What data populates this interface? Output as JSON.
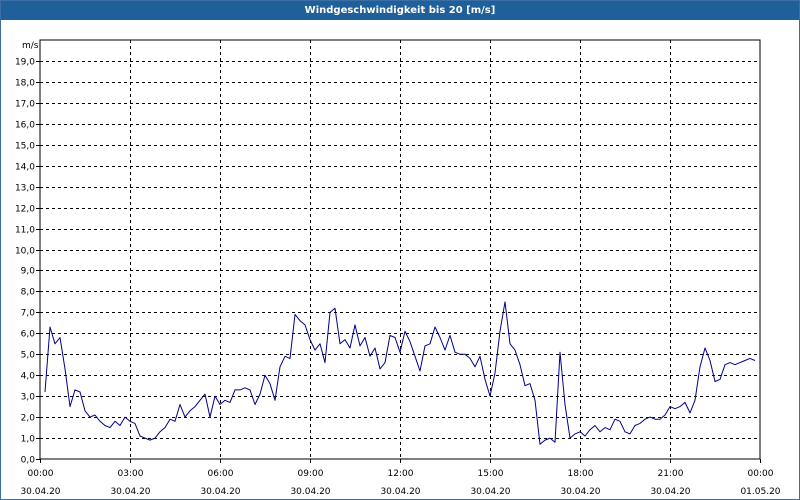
{
  "window": {
    "title": "Windgeschwindigkeit bis 20 [m/s]"
  },
  "chart_data": {
    "type": "line",
    "title": "Windgeschwindigkeit bis 20 [m/s]",
    "ylabel": "m/s",
    "ylim": [
      0,
      20
    ],
    "y_ticks": [
      "0,0",
      "1,0",
      "2,0",
      "3,0",
      "4,0",
      "5,0",
      "6,0",
      "7,0",
      "8,0",
      "9,0",
      "10,0",
      "11,0",
      "12,0",
      "13,0",
      "14,0",
      "15,0",
      "16,0",
      "17,0",
      "18,0",
      "19,0"
    ],
    "x_ticks": [
      {
        "time": "00:00",
        "date": "30.04.20"
      },
      {
        "time": "03:00",
        "date": "30.04.20"
      },
      {
        "time": "06:00",
        "date": "30.04.20"
      },
      {
        "time": "09:00",
        "date": "30.04.20"
      },
      {
        "time": "12:00",
        "date": "30.04.20"
      },
      {
        "time": "15:00",
        "date": "30.04.20"
      },
      {
        "time": "18:00",
        "date": "30.04.20"
      },
      {
        "time": "21:00",
        "date": "30.04.20"
      },
      {
        "time": "00:00",
        "date": "01.05.20"
      }
    ],
    "grid": true,
    "line_color": "#00008b",
    "series": [
      {
        "x": [
          "00:10",
          "00:20",
          "00:30",
          "00:40",
          "00:50",
          "01:00",
          "01:10",
          "01:20",
          "01:30",
          "01:40",
          "01:50",
          "02:00",
          "02:10",
          "02:20",
          "02:30",
          "02:40",
          "02:50",
          "03:00",
          "03:10",
          "03:20",
          "03:30",
          "03:40",
          "03:50",
          "04:00",
          "04:10",
          "04:20",
          "04:30",
          "04:40",
          "04:50",
          "05:00",
          "05:10",
          "05:20",
          "05:30",
          "05:40",
          "05:50",
          "06:00",
          "06:10",
          "06:20",
          "06:30",
          "06:40",
          "06:50",
          "07:00",
          "07:10",
          "07:20",
          "07:30",
          "07:40",
          "07:50",
          "08:00",
          "08:10",
          "08:20",
          "08:30",
          "08:40",
          "08:50",
          "09:00",
          "09:10",
          "09:20",
          "09:30",
          "09:40",
          "09:50",
          "10:00",
          "10:10",
          "10:20",
          "10:30",
          "10:40",
          "10:50",
          "11:00",
          "11:10",
          "11:20",
          "11:30",
          "11:40",
          "11:50",
          "12:00",
          "12:10",
          "12:20",
          "12:30",
          "12:40",
          "12:50",
          "13:00",
          "13:10",
          "13:20",
          "13:30",
          "13:40",
          "13:50",
          "14:00",
          "14:10",
          "14:20",
          "14:30",
          "14:40",
          "14:50",
          "15:00",
          "15:10",
          "15:20",
          "15:30",
          "15:40",
          "15:50",
          "16:00",
          "16:10",
          "16:20",
          "16:30",
          "16:40",
          "16:50",
          "17:00",
          "17:10",
          "17:20",
          "17:30",
          "17:40",
          "17:50",
          "18:00",
          "18:10",
          "18:20",
          "18:30",
          "18:40",
          "18:50",
          "19:00",
          "19:10",
          "19:20",
          "19:30",
          "19:40",
          "19:50",
          "20:00",
          "20:10",
          "20:20",
          "20:30",
          "20:40",
          "20:50",
          "21:00",
          "21:10",
          "21:20",
          "21:30",
          "21:40",
          "21:50",
          "22:00",
          "22:10",
          "22:20",
          "22:30",
          "22:40",
          "22:50",
          "23:00",
          "23:10",
          "23:20",
          "23:30",
          "23:40",
          "23:50"
        ],
        "values": [
          3.2,
          6.3,
          5.5,
          5.8,
          4.3,
          2.5,
          3.3,
          3.2,
          2.3,
          2.0,
          2.1,
          1.8,
          1.6,
          1.5,
          1.8,
          1.6,
          2.0,
          1.8,
          1.7,
          1.1,
          1.0,
          0.9,
          1.0,
          1.3,
          1.5,
          1.9,
          1.8,
          2.6,
          2.0,
          2.3,
          2.5,
          2.8,
          3.1,
          2.0,
          3.0,
          2.6,
          2.8,
          2.7,
          3.3,
          3.3,
          3.4,
          3.3,
          2.6,
          3.1,
          4.0,
          3.6,
          2.8,
          4.4,
          4.9,
          4.8,
          6.9,
          6.6,
          6.4,
          5.7,
          5.2,
          5.5,
          4.6,
          7.0,
          7.2,
          5.5,
          5.7,
          5.3,
          6.4,
          5.4,
          5.8,
          4.9,
          5.3,
          4.3,
          4.6,
          5.9,
          5.8,
          5.1,
          6.1,
          5.6,
          4.9,
          4.2,
          5.4,
          5.5,
          6.3,
          5.8,
          5.2,
          5.9,
          5.1,
          5.0,
          5.0,
          4.8,
          4.4,
          4.9,
          3.8,
          3.0,
          4.1,
          6.1,
          7.5,
          5.5,
          5.2,
          4.5,
          3.5,
          3.6,
          2.8,
          0.7,
          0.9,
          1.0,
          0.8,
          5.1,
          2.6,
          1.0,
          1.2,
          1.3,
          1.1,
          1.4,
          1.6,
          1.3,
          1.5,
          1.4,
          1.9,
          1.8,
          1.3,
          1.2,
          1.6,
          1.7,
          1.9,
          2.0,
          1.9,
          1.9,
          2.1,
          2.5,
          2.4,
          2.5,
          2.7,
          2.2,
          2.8,
          4.4,
          5.3,
          4.7,
          3.7,
          3.8,
          4.5,
          4.6,
          4.5,
          4.6,
          4.7,
          4.8,
          4.7
        ]
      }
    ]
  }
}
